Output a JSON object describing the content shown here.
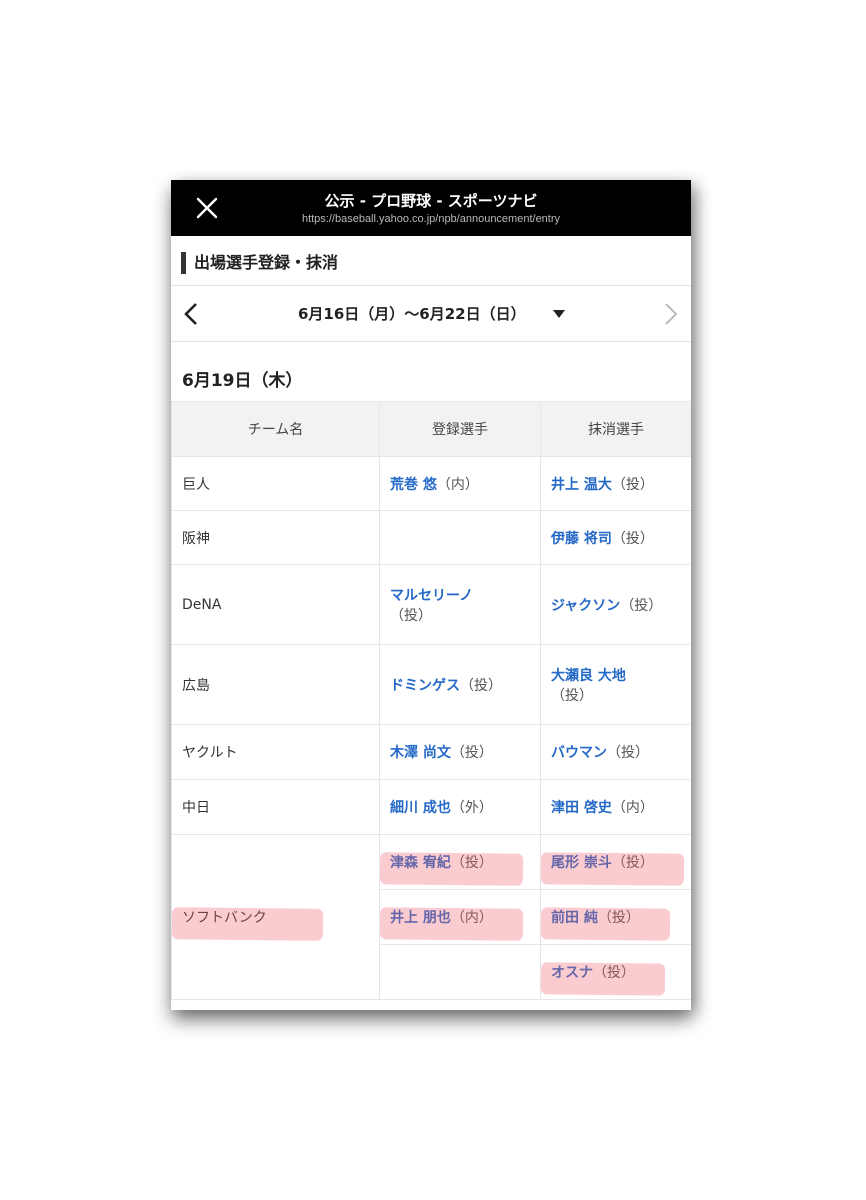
{
  "window": {
    "title": "公示 - プロ野球 - スポーツナビ",
    "url": "https://baseball.yahoo.co.jp/npb/announcement/entry",
    "close_icon": "close-icon"
  },
  "section": {
    "heading": "出場選手登録・抹消"
  },
  "nav": {
    "range_label": "6月16日（月）～6月22日（日）",
    "prev_icon": "chevron-left-icon",
    "next_icon": "chevron-right-icon",
    "dropdown_icon": "caret-down-icon"
  },
  "date_heading": "6月19日（木）",
  "table": {
    "headers": [
      "チーム名",
      "登録選手",
      "抹消選手"
    ],
    "rows": [
      {
        "team": "巨人",
        "reg": [
          {
            "name": "荒巻 悠",
            "pos": "（内）"
          }
        ],
        "dereg": [
          {
            "name": "井上 温大",
            "pos": "（投）"
          }
        ]
      },
      {
        "team": "阪神",
        "reg": [],
        "dereg": [
          {
            "name": "伊藤 将司",
            "pos": "（投）"
          }
        ]
      },
      {
        "team": "DeNA",
        "reg": [
          {
            "name": "マルセリーノ",
            "pos": "（投）"
          }
        ],
        "dereg": [
          {
            "name": "ジャクソン",
            "pos": "（投）"
          }
        ]
      },
      {
        "team": "広島",
        "reg": [
          {
            "name": "ドミンゲス",
            "pos": "（投）"
          }
        ],
        "dereg": [
          {
            "name": "大瀬良 大地",
            "pos": "（投）"
          }
        ]
      },
      {
        "team": "ヤクルト",
        "reg": [
          {
            "name": "木澤 尚文",
            "pos": "（投）"
          }
        ],
        "dereg": [
          {
            "name": "バウマン",
            "pos": "（投）"
          }
        ]
      },
      {
        "team": "中日",
        "reg": [
          {
            "name": "細川 成也",
            "pos": "（外）"
          }
        ],
        "dereg": [
          {
            "name": "津田 啓史",
            "pos": "（内）"
          }
        ]
      },
      {
        "team": "ソフトバンク",
        "reg": [
          {
            "name": "津森 宥紀",
            "pos": "（投）"
          },
          {
            "name": "井上 朋也",
            "pos": "（内）"
          }
        ],
        "dereg": [
          {
            "name": "尾形 崇斗",
            "pos": "（投）"
          },
          {
            "name": "前田 純",
            "pos": "（投）"
          },
          {
            "name": "オスナ",
            "pos": "（投）"
          }
        ]
      }
    ]
  },
  "highlight_color": "#f05f6e"
}
